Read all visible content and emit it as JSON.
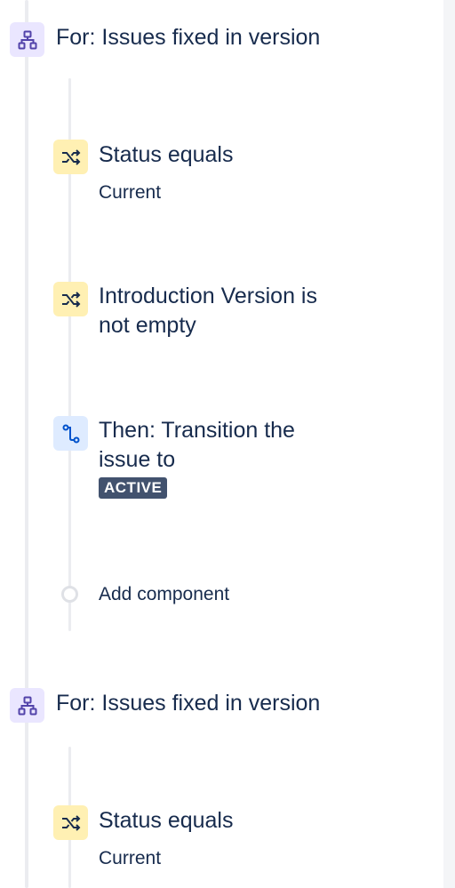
{
  "colors": {
    "branch_icon": "#5243aa",
    "condition_icon": "#172b4d",
    "action_icon": "#0052cc",
    "lozenge_bg": "#42526e"
  },
  "rule": [
    {
      "branch": {
        "label": "For: Issues fixed in version",
        "icon": "branch-icon"
      },
      "steps": [
        {
          "type": "condition",
          "icon": "shuffle-icon",
          "title": "Status equals",
          "detail": "Current"
        },
        {
          "type": "condition",
          "icon": "shuffle-icon",
          "title_line1": "Introduction Version is",
          "title_line2": "not empty"
        },
        {
          "type": "action",
          "icon": "transition-icon",
          "title_line1": "Then: Transition the",
          "title_line2": "issue to",
          "badge": "ACTIVE"
        }
      ],
      "add_component": "Add component"
    },
    {
      "branch": {
        "label": "For: Issues fixed in version",
        "icon": "branch-icon"
      },
      "steps": [
        {
          "type": "condition",
          "icon": "shuffle-icon",
          "title": "Status equals",
          "detail": "Current"
        }
      ]
    }
  ]
}
